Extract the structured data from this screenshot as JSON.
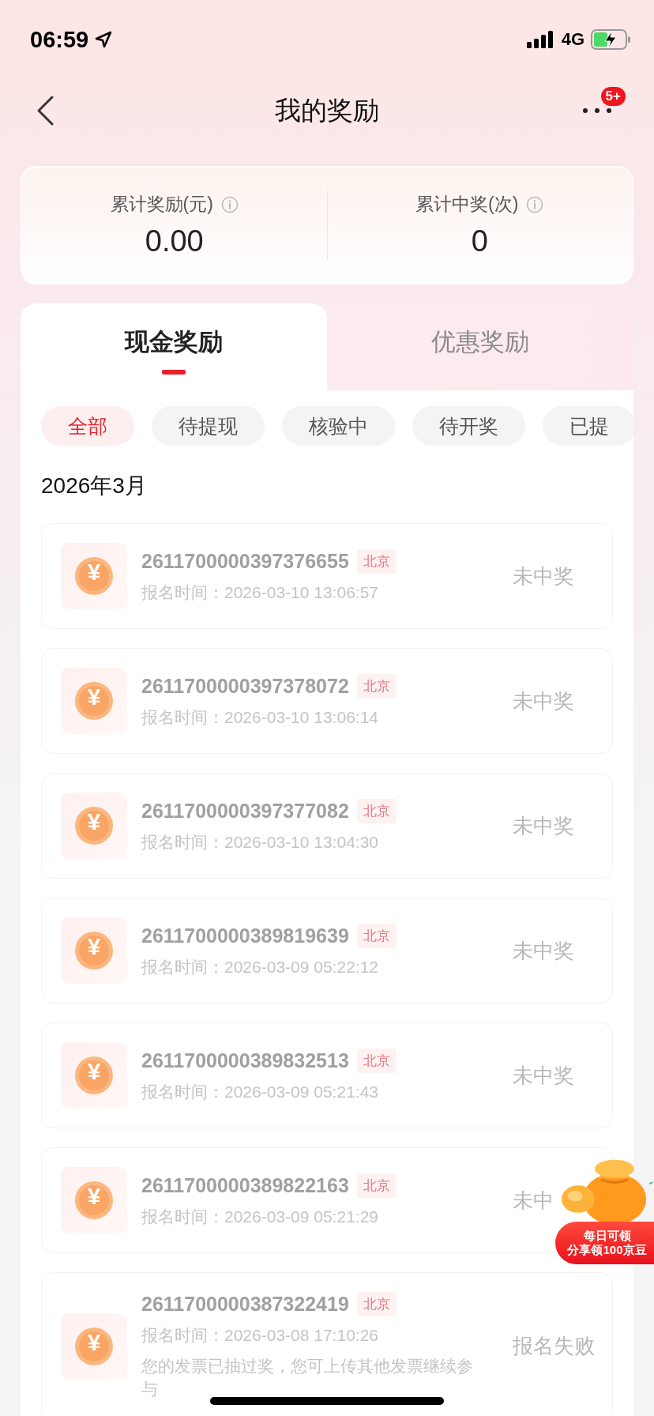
{
  "status_bar": {
    "time": "06:59",
    "network": "4G"
  },
  "nav": {
    "title": "我的奖励",
    "badge": "5+"
  },
  "summary": [
    {
      "label": "累计奖励(元)",
      "value": "0.00"
    },
    {
      "label": "累计中奖(次)",
      "value": "0"
    }
  ],
  "tabs": [
    {
      "label": "现金奖励",
      "selected": true
    },
    {
      "label": "优惠奖励",
      "selected": false
    }
  ],
  "filters": [
    {
      "label": "全部",
      "selected": true
    },
    {
      "label": "待提现",
      "selected": false
    },
    {
      "label": "核验中",
      "selected": false
    },
    {
      "label": "待开奖",
      "selected": false
    },
    {
      "label": "已提",
      "selected": false
    }
  ],
  "month": "2026年3月",
  "records": [
    {
      "coin": "¥",
      "number": "2611700000397376655",
      "region": "北京",
      "time": "报名时间：2026-03-10 13:06:57",
      "status": "未中奖"
    },
    {
      "coin": "¥",
      "number": "2611700000397378072",
      "region": "北京",
      "time": "报名时间：2026-03-10 13:06:14",
      "status": "未中奖"
    },
    {
      "coin": "¥",
      "number": "2611700000397377082",
      "region": "北京",
      "time": "报名时间：2026-03-10 13:04:30",
      "status": "未中奖"
    },
    {
      "coin": "¥",
      "number": "2611700000389819639",
      "region": "北京",
      "time": "报名时间：2026-03-09 05:22:12",
      "status": "未中奖"
    },
    {
      "coin": "¥",
      "number": "2611700000389832513",
      "region": "北京",
      "time": "报名时间：2026-03-09 05:21:43",
      "status": "未中奖"
    },
    {
      "coin": "¥",
      "number": "2611700000389822163",
      "region": "北京",
      "time": "报名时间：2026-03-09 05:21:29",
      "status": "未中"
    },
    {
      "coin": "¥",
      "number": "2611700000387322419",
      "region": "北京",
      "time": "报名时间：2026-03-08 17:10:26",
      "note": "您的发票已抽过奖，您可上传其他发票继续参与",
      "status": "报名失败"
    }
  ],
  "promo": {
    "line1": "每日可领",
    "line2": "分享领100京豆"
  }
}
